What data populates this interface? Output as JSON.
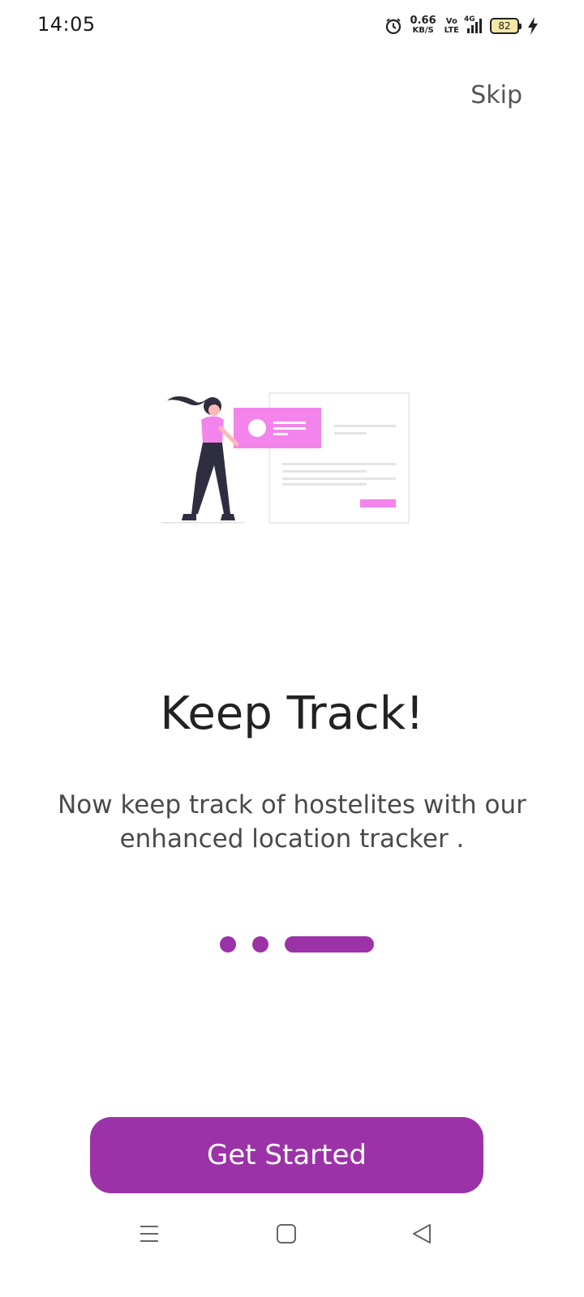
{
  "status_bar": {
    "time": "14:05",
    "net_speed_value": "0.66",
    "net_speed_unit": "KB/S",
    "volte_top": "Vo",
    "volte_bottom": "LTE",
    "network_type": "4G",
    "battery_level": "82",
    "icons": [
      "alarm-icon",
      "signal-icon",
      "battery-icon",
      "charging-bolt-icon"
    ]
  },
  "header": {
    "skip_label": "Skip"
  },
  "onboarding": {
    "title": "Keep Track!",
    "description": "Now keep track of hostelites with our enhanced location tracker .",
    "page_count": 3,
    "current_page": 3,
    "illustration": "person-with-profile-card-illustration"
  },
  "actions": {
    "get_started_label": "Get Started"
  },
  "nav_bar": {
    "icons": [
      "menu-icon",
      "home-icon",
      "back-icon"
    ]
  },
  "colors": {
    "accent": "#9c32a8",
    "illustration_accent": "#f384ec",
    "text_primary": "#222222",
    "text_secondary": "#4a4a4a"
  }
}
